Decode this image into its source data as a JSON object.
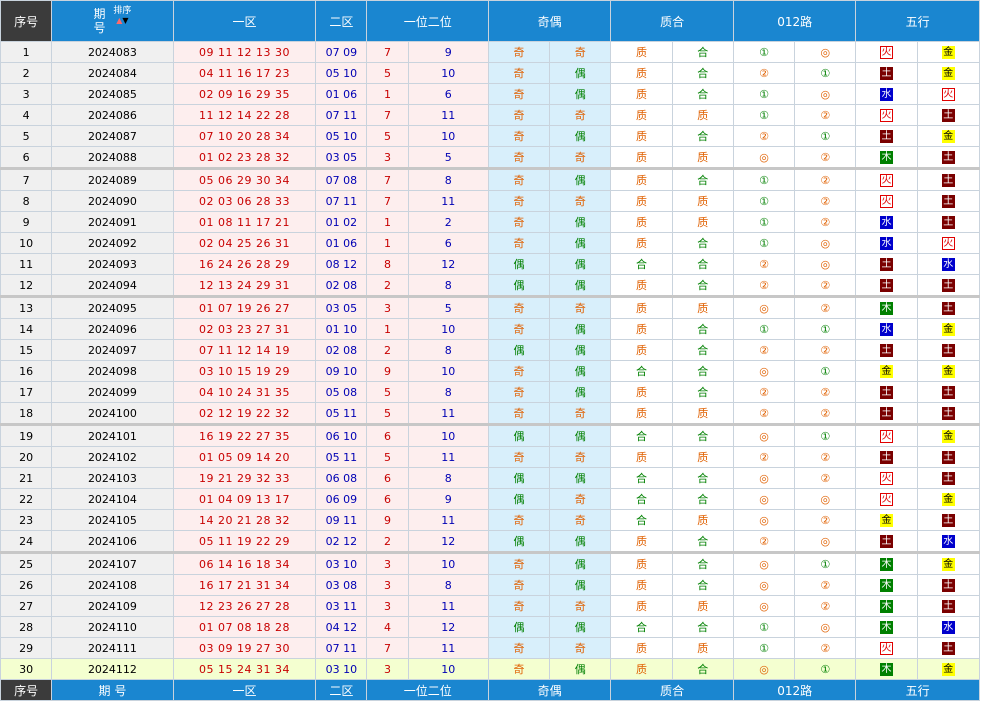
{
  "header": {
    "seq": "序号",
    "issue_line1": "期",
    "issue_line2": "号",
    "sort_label": "排序",
    "zone1": "一区",
    "zone2": "二区",
    "pos12": "一位二位",
    "odd_even": "奇偶",
    "prime_comp": "质合",
    "road012": "012路",
    "five_elements": "五行"
  },
  "footer": {
    "seq": "序号",
    "issue": "期 号",
    "zone1": "一区",
    "zone2": "二区",
    "pos12": "一位二位",
    "odd_even": "奇偶",
    "prime_comp": "质合",
    "road012": "012路",
    "five_elements": "五行"
  },
  "colors": {
    "header_bg": "#1a86d0",
    "zone1_text": "#c80000",
    "zone2_text": "#0000b4",
    "last_row_bg": "#f4ffd0"
  },
  "rows": [
    {
      "seq": "1",
      "issue": "2024083",
      "zone1": "09 11 12 13 30",
      "zone2": "07 09",
      "pos1": "7",
      "pos2": "9",
      "oe1": "奇",
      "oe2": "奇",
      "pc1": "质",
      "pc2": "合",
      "r1": "①",
      "r2": "◎",
      "w1": "火",
      "w2": "金"
    },
    {
      "seq": "2",
      "issue": "2024084",
      "zone1": "04 11 16 17 23",
      "zone2": "05 10",
      "pos1": "5",
      "pos2": "10",
      "oe1": "奇",
      "oe2": "偶",
      "pc1": "质",
      "pc2": "合",
      "r1": "②",
      "r2": "①",
      "w1": "土",
      "w2": "金"
    },
    {
      "seq": "3",
      "issue": "2024085",
      "zone1": "02 09 16 29 35",
      "zone2": "01 06",
      "pos1": "1",
      "pos2": "6",
      "oe1": "奇",
      "oe2": "偶",
      "pc1": "质",
      "pc2": "合",
      "r1": "①",
      "r2": "◎",
      "w1": "水",
      "w2": "火"
    },
    {
      "seq": "4",
      "issue": "2024086",
      "zone1": "11 12 14 22 28",
      "zone2": "07 11",
      "pos1": "7",
      "pos2": "11",
      "oe1": "奇",
      "oe2": "奇",
      "pc1": "质",
      "pc2": "质",
      "r1": "①",
      "r2": "②",
      "w1": "火",
      "w2": "土"
    },
    {
      "seq": "5",
      "issue": "2024087",
      "zone1": "07 10 20 28 34",
      "zone2": "05 10",
      "pos1": "5",
      "pos2": "10",
      "oe1": "奇",
      "oe2": "偶",
      "pc1": "质",
      "pc2": "合",
      "r1": "②",
      "r2": "①",
      "w1": "土",
      "w2": "金"
    },
    {
      "seq": "6",
      "issue": "2024088",
      "zone1": "01 02 23 28 32",
      "zone2": "03 05",
      "pos1": "3",
      "pos2": "5",
      "oe1": "奇",
      "oe2": "奇",
      "pc1": "质",
      "pc2": "质",
      "r1": "◎",
      "r2": "②",
      "w1": "木",
      "w2": "土"
    },
    {
      "seq": "7",
      "issue": "2024089",
      "zone1": "05 06 29 30 34",
      "zone2": "07 08",
      "pos1": "7",
      "pos2": "8",
      "oe1": "奇",
      "oe2": "偶",
      "pc1": "质",
      "pc2": "合",
      "r1": "①",
      "r2": "②",
      "w1": "火",
      "w2": "土"
    },
    {
      "seq": "8",
      "issue": "2024090",
      "zone1": "02 03 06 28 33",
      "zone2": "07 11",
      "pos1": "7",
      "pos2": "11",
      "oe1": "奇",
      "oe2": "奇",
      "pc1": "质",
      "pc2": "质",
      "r1": "①",
      "r2": "②",
      "w1": "火",
      "w2": "土"
    },
    {
      "seq": "9",
      "issue": "2024091",
      "zone1": "01 08 11 17 21",
      "zone2": "01 02",
      "pos1": "1",
      "pos2": "2",
      "oe1": "奇",
      "oe2": "偶",
      "pc1": "质",
      "pc2": "质",
      "r1": "①",
      "r2": "②",
      "w1": "水",
      "w2": "土"
    },
    {
      "seq": "10",
      "issue": "2024092",
      "zone1": "02 04 25 26 31",
      "zone2": "01 06",
      "pos1": "1",
      "pos2": "6",
      "oe1": "奇",
      "oe2": "偶",
      "pc1": "质",
      "pc2": "合",
      "r1": "①",
      "r2": "◎",
      "w1": "水",
      "w2": "火"
    },
    {
      "seq": "11",
      "issue": "2024093",
      "zone1": "16 24 26 28 29",
      "zone2": "08 12",
      "pos1": "8",
      "pos2": "12",
      "oe1": "偶",
      "oe2": "偶",
      "pc1": "合",
      "pc2": "合",
      "r1": "②",
      "r2": "◎",
      "w1": "土",
      "w2": "水"
    },
    {
      "seq": "12",
      "issue": "2024094",
      "zone1": "12 13 24 29 31",
      "zone2": "02 08",
      "pos1": "2",
      "pos2": "8",
      "oe1": "偶",
      "oe2": "偶",
      "pc1": "质",
      "pc2": "合",
      "r1": "②",
      "r2": "②",
      "w1": "土",
      "w2": "土"
    },
    {
      "seq": "13",
      "issue": "2024095",
      "zone1": "01 07 19 26 27",
      "zone2": "03 05",
      "pos1": "3",
      "pos2": "5",
      "oe1": "奇",
      "oe2": "奇",
      "pc1": "质",
      "pc2": "质",
      "r1": "◎",
      "r2": "②",
      "w1": "木",
      "w2": "土"
    },
    {
      "seq": "14",
      "issue": "2024096",
      "zone1": "02 03 23 27 31",
      "zone2": "01 10",
      "pos1": "1",
      "pos2": "10",
      "oe1": "奇",
      "oe2": "偶",
      "pc1": "质",
      "pc2": "合",
      "r1": "①",
      "r2": "①",
      "w1": "水",
      "w2": "金"
    },
    {
      "seq": "15",
      "issue": "2024097",
      "zone1": "07 11 12 14 19",
      "zone2": "02 08",
      "pos1": "2",
      "pos2": "8",
      "oe1": "偶",
      "oe2": "偶",
      "pc1": "质",
      "pc2": "合",
      "r1": "②",
      "r2": "②",
      "w1": "土",
      "w2": "土"
    },
    {
      "seq": "16",
      "issue": "2024098",
      "zone1": "03 10 15 19 29",
      "zone2": "09 10",
      "pos1": "9",
      "pos2": "10",
      "oe1": "奇",
      "oe2": "偶",
      "pc1": "合",
      "pc2": "合",
      "r1": "◎",
      "r2": "①",
      "w1": "金",
      "w2": "金"
    },
    {
      "seq": "17",
      "issue": "2024099",
      "zone1": "04 10 24 31 35",
      "zone2": "05 08",
      "pos1": "5",
      "pos2": "8",
      "oe1": "奇",
      "oe2": "偶",
      "pc1": "质",
      "pc2": "合",
      "r1": "②",
      "r2": "②",
      "w1": "土",
      "w2": "土"
    },
    {
      "seq": "18",
      "issue": "2024100",
      "zone1": "02 12 19 22 32",
      "zone2": "05 11",
      "pos1": "5",
      "pos2": "11",
      "oe1": "奇",
      "oe2": "奇",
      "pc1": "质",
      "pc2": "质",
      "r1": "②",
      "r2": "②",
      "w1": "土",
      "w2": "土"
    },
    {
      "seq": "19",
      "issue": "2024101",
      "zone1": "16 19 22 27 35",
      "zone2": "06 10",
      "pos1": "6",
      "pos2": "10",
      "oe1": "偶",
      "oe2": "偶",
      "pc1": "合",
      "pc2": "合",
      "r1": "◎",
      "r2": "①",
      "w1": "火",
      "w2": "金"
    },
    {
      "seq": "20",
      "issue": "2024102",
      "zone1": "01 05 09 14 20",
      "zone2": "05 11",
      "pos1": "5",
      "pos2": "11",
      "oe1": "奇",
      "oe2": "奇",
      "pc1": "质",
      "pc2": "质",
      "r1": "②",
      "r2": "②",
      "w1": "土",
      "w2": "土"
    },
    {
      "seq": "21",
      "issue": "2024103",
      "zone1": "19 21 29 32 33",
      "zone2": "06 08",
      "pos1": "6",
      "pos2": "8",
      "oe1": "偶",
      "oe2": "偶",
      "pc1": "合",
      "pc2": "合",
      "r1": "◎",
      "r2": "②",
      "w1": "火",
      "w2": "土"
    },
    {
      "seq": "22",
      "issue": "2024104",
      "zone1": "01 04 09 13 17",
      "zone2": "06 09",
      "pos1": "6",
      "pos2": "9",
      "oe1": "偶",
      "oe2": "奇",
      "pc1": "合",
      "pc2": "合",
      "r1": "◎",
      "r2": "◎",
      "w1": "火",
      "w2": "金"
    },
    {
      "seq": "23",
      "issue": "2024105",
      "zone1": "14 20 21 28 32",
      "zone2": "09 11",
      "pos1": "9",
      "pos2": "11",
      "oe1": "奇",
      "oe2": "奇",
      "pc1": "合",
      "pc2": "质",
      "r1": "◎",
      "r2": "②",
      "w1": "金",
      "w2": "土"
    },
    {
      "seq": "24",
      "issue": "2024106",
      "zone1": "05 11 19 22 29",
      "zone2": "02 12",
      "pos1": "2",
      "pos2": "12",
      "oe1": "偶",
      "oe2": "偶",
      "pc1": "质",
      "pc2": "合",
      "r1": "②",
      "r2": "◎",
      "w1": "土",
      "w2": "水"
    },
    {
      "seq": "25",
      "issue": "2024107",
      "zone1": "06 14 16 18 34",
      "zone2": "03 10",
      "pos1": "3",
      "pos2": "10",
      "oe1": "奇",
      "oe2": "偶",
      "pc1": "质",
      "pc2": "合",
      "r1": "◎",
      "r2": "①",
      "w1": "木",
      "w2": "金"
    },
    {
      "seq": "26",
      "issue": "2024108",
      "zone1": "16 17 21 31 34",
      "zone2": "03 08",
      "pos1": "3",
      "pos2": "8",
      "oe1": "奇",
      "oe2": "偶",
      "pc1": "质",
      "pc2": "合",
      "r1": "◎",
      "r2": "②",
      "w1": "木",
      "w2": "土"
    },
    {
      "seq": "27",
      "issue": "2024109",
      "zone1": "12 23 26 27 28",
      "zone2": "03 11",
      "pos1": "3",
      "pos2": "11",
      "oe1": "奇",
      "oe2": "奇",
      "pc1": "质",
      "pc2": "质",
      "r1": "◎",
      "r2": "②",
      "w1": "木",
      "w2": "土"
    },
    {
      "seq": "28",
      "issue": "2024110",
      "zone1": "01 07 08 18 28",
      "zone2": "04 12",
      "pos1": "4",
      "pos2": "12",
      "oe1": "偶",
      "oe2": "偶",
      "pc1": "合",
      "pc2": "合",
      "r1": "①",
      "r2": "◎",
      "w1": "木",
      "w2": "水"
    },
    {
      "seq": "29",
      "issue": "2024111",
      "zone1": "03 09 19 27 30",
      "zone2": "07 11",
      "pos1": "7",
      "pos2": "11",
      "oe1": "奇",
      "oe2": "奇",
      "pc1": "质",
      "pc2": "质",
      "r1": "①",
      "r2": "②",
      "w1": "火",
      "w2": "土"
    },
    {
      "seq": "30",
      "issue": "2024112",
      "zone1": "05 15 24 31 34",
      "zone2": "03 10",
      "pos1": "3",
      "pos2": "10",
      "oe1": "奇",
      "oe2": "偶",
      "pc1": "质",
      "pc2": "合",
      "r1": "◎",
      "r2": "①",
      "w1": "木",
      "w2": "金"
    }
  ]
}
